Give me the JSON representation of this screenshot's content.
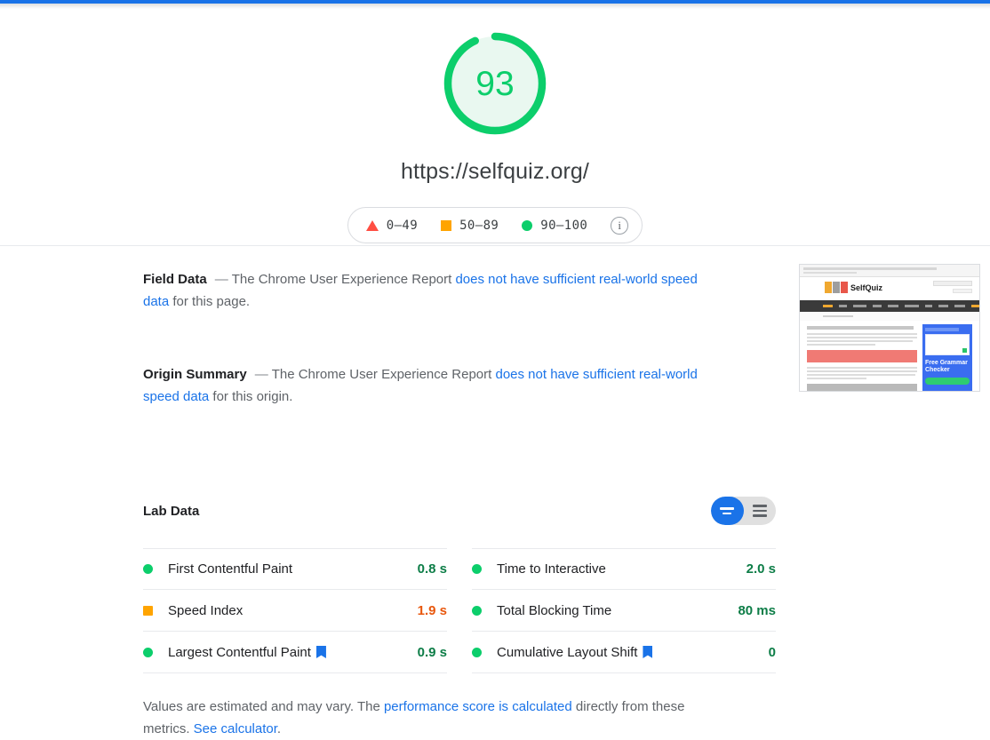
{
  "topbar": {
    "color": "#1a73e8"
  },
  "score": {
    "value": "93",
    "url": "https://selfquiz.org/",
    "color": "#0cce6b",
    "percent": 93
  },
  "legend": {
    "items": [
      {
        "marker": "triangle",
        "label": "0–49",
        "color": "#ff4e42"
      },
      {
        "marker": "square",
        "label": "50–89",
        "color": "#ffa400"
      },
      {
        "marker": "circle",
        "label": "90–100",
        "color": "#0cce6b"
      }
    ],
    "info_icon": "info-icon",
    "info_glyph": "i"
  },
  "field_data": {
    "title": "Field Data",
    "dash": "—",
    "text_before": "The Chrome User Experience Report ",
    "link": "does not have sufficient real-world speed data",
    "text_after": " for this page."
  },
  "origin_summary": {
    "title": "Origin Summary",
    "dash": "—",
    "text_before": "The Chrome User Experience Report ",
    "link": "does not have sufficient real-world speed data",
    "text_after": " for this origin."
  },
  "thumbnail": {
    "name": "page-screenshot-thumbnail",
    "logo_text": "SelfQuiz",
    "ad_text": "Free Grammar Checker"
  },
  "lab_data": {
    "title": "Lab Data",
    "toggle": {
      "active_icon": "collapsed-view-icon",
      "inactive_icon": "expanded-view-icon",
      "active_color": "#1a73e8",
      "inactive_color": "#e0e0e0"
    },
    "columns": [
      {
        "rows": [
          {
            "status": "pass",
            "marker": "circle",
            "marker_color": "#0cce6b",
            "name": "First Contentful Paint",
            "cwv": false,
            "value": "0.8 s",
            "value_color": "#0d7d47"
          },
          {
            "status": "average",
            "marker": "square",
            "marker_color": "#ffa400",
            "name": "Speed Index",
            "cwv": false,
            "value": "1.9 s",
            "value_color": "#e8570d"
          },
          {
            "status": "pass",
            "marker": "circle",
            "marker_color": "#0cce6b",
            "name": "Largest Contentful Paint",
            "cwv": true,
            "value": "0.9 s",
            "value_color": "#0d7d47"
          }
        ]
      },
      {
        "rows": [
          {
            "status": "pass",
            "marker": "circle",
            "marker_color": "#0cce6b",
            "name": "Time to Interactive",
            "cwv": false,
            "value": "2.0 s",
            "value_color": "#0d7d47"
          },
          {
            "status": "pass",
            "marker": "circle",
            "marker_color": "#0cce6b",
            "name": "Total Blocking Time",
            "cwv": false,
            "value": "80 ms",
            "value_color": "#0d7d47"
          },
          {
            "status": "pass",
            "marker": "circle",
            "marker_color": "#0cce6b",
            "name": "Cumulative Layout Shift",
            "cwv": true,
            "value": "0",
            "value_color": "#0d7d47"
          }
        ]
      }
    ]
  },
  "footnote": {
    "text_before": "Values are estimated and may vary. The ",
    "link1": "performance score is calculated",
    "text_mid": " directly from these metrics. ",
    "link2": "See calculator",
    "text_after": "."
  }
}
